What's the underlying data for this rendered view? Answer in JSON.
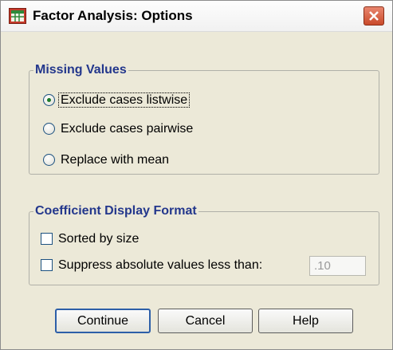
{
  "window": {
    "title": "Factor Analysis: Options",
    "app_icon": "spss-table-icon",
    "close_icon": "close-icon"
  },
  "missing_values": {
    "legend": "Missing Values",
    "options": [
      {
        "label": "Exclude cases listwise",
        "selected": true
      },
      {
        "label": "Exclude cases pairwise",
        "selected": false
      },
      {
        "label": "Replace with mean",
        "selected": false
      }
    ]
  },
  "coefficient_format": {
    "legend": "Coefficient Display Format",
    "sorted_by_size": {
      "label": "Sorted by size",
      "checked": false
    },
    "suppress": {
      "label": "Suppress absolute values less than:",
      "checked": false,
      "value": ".10"
    }
  },
  "buttons": {
    "continue": "Continue",
    "cancel": "Cancel",
    "help": "Help"
  },
  "colors": {
    "legend": "#23378c",
    "dialog_bg": "#ece9d8",
    "close_button": "#c94a2a"
  }
}
